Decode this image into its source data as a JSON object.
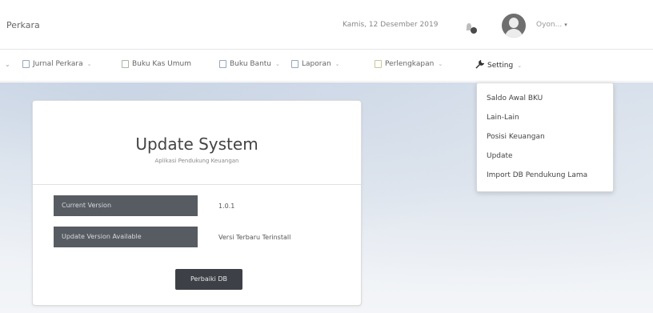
{
  "header": {
    "title": "Perkara",
    "date": "Kamis, 12 Desember 2019",
    "username": "Oyon..."
  },
  "menu": {
    "items": [
      {
        "label": "Jurnal Perkara",
        "icon": "document-icon"
      },
      {
        "label": "Buku Kas Umum",
        "icon": "book-icon"
      },
      {
        "label": "Buku Bantu",
        "icon": "document-icon"
      },
      {
        "label": "Laporan",
        "icon": "document-icon"
      },
      {
        "label": "Perlengkapan",
        "icon": "document-icon"
      },
      {
        "label": "Setting",
        "icon": "wrench-icon"
      }
    ]
  },
  "dropdown": {
    "items": [
      "Saldo Awal BKU",
      "Lain-Lain",
      "Posisi Keuangan",
      "Update",
      "Import DB Pendukung Lama"
    ]
  },
  "card": {
    "title": "Update System",
    "subtitle": "Aplikasi Pendukung Keuangan",
    "rows": [
      {
        "label": "Current Version",
        "value": "1.0.1"
      },
      {
        "label": "Update Version Available",
        "value": "Versi Terbaru Terinstall"
      }
    ],
    "button": "Perbaiki DB"
  },
  "colors": {
    "button_bg": "#3d4147",
    "row_label_bg": "#575c63"
  }
}
